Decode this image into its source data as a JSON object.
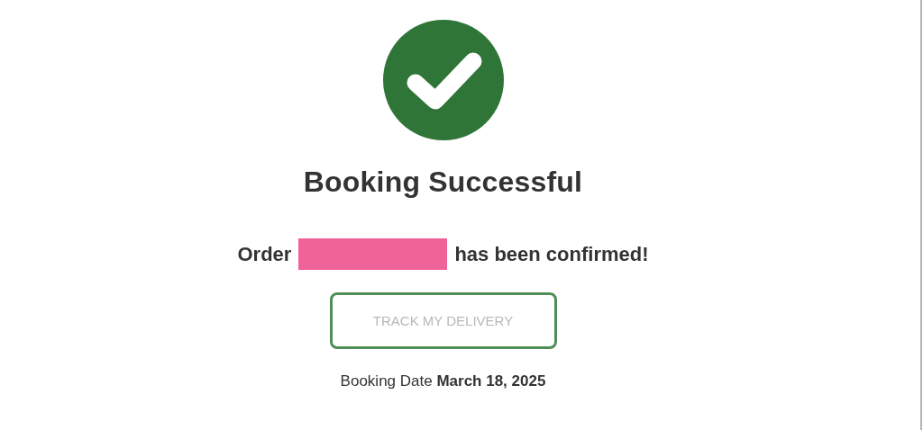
{
  "status_icon": {
    "kind": "success"
  },
  "title": "Booking Successful",
  "order_message": {
    "prefix": "Order",
    "id_redacted": true,
    "suffix": "has been confirmed!"
  },
  "button": {
    "label": "TRACK MY DELIVERY"
  },
  "booking_date": "Booking Date **March 18, 2025**"
}
